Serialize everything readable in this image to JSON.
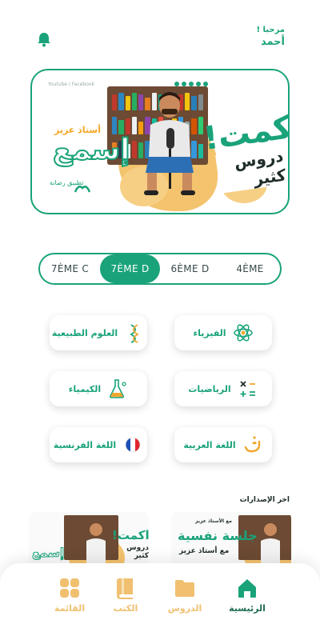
{
  "header": {
    "greeting": "مرحبا !",
    "user_name": "أحمد"
  },
  "banner": {
    "brand_line1": "راكمت!",
    "brand_line2": "دروس كثير",
    "tagline": "أستاذ عزيز",
    "big_name": "إسمع",
    "app_label": "تطبيق رصانة",
    "social_text": "Youtube / Facebook"
  },
  "grades": [
    {
      "label": "7ÈME C",
      "active": false
    },
    {
      "label": "7ÈME D",
      "active": true
    },
    {
      "label": "6ÈME D",
      "active": false
    },
    {
      "label": "4ÈME",
      "active": false
    }
  ],
  "subjects": [
    {
      "label": "الفيزياء",
      "icon": "atom-icon"
    },
    {
      "label": "العلوم الطبيعية",
      "icon": "dna-icon"
    },
    {
      "label": "الرياضيات",
      "icon": "math-operators-icon"
    },
    {
      "label": "الكيمياء",
      "icon": "flask-icon"
    },
    {
      "label": "اللغة العربية",
      "icon": "arabic-letter-icon"
    },
    {
      "label": "اللغة الفرنسية",
      "icon": "french-flag-icon"
    }
  ],
  "latest": {
    "title": "اخر الإصدارات",
    "items": [
      {
        "line1": "جلسة نفسية",
        "line2": "مع أستاذ عزيز",
        "small": "مع الأستاذ عزيز"
      },
      {
        "line1": "راكمت!",
        "line2": "دروس كثير",
        "big": "إسمع"
      }
    ]
  },
  "nav": [
    {
      "label": "الرئيسية",
      "icon": "home-icon",
      "active": true
    },
    {
      "label": "الدروس",
      "icon": "folder-icon",
      "active": false
    },
    {
      "label": "الكتب",
      "icon": "book-icon",
      "active": false
    },
    {
      "label": "القائمة",
      "icon": "grid-menu-icon",
      "active": false
    }
  ],
  "colors": {
    "primary": "#1aa37a",
    "accent": "#f0c070",
    "nav_active": "#1f6b55"
  }
}
